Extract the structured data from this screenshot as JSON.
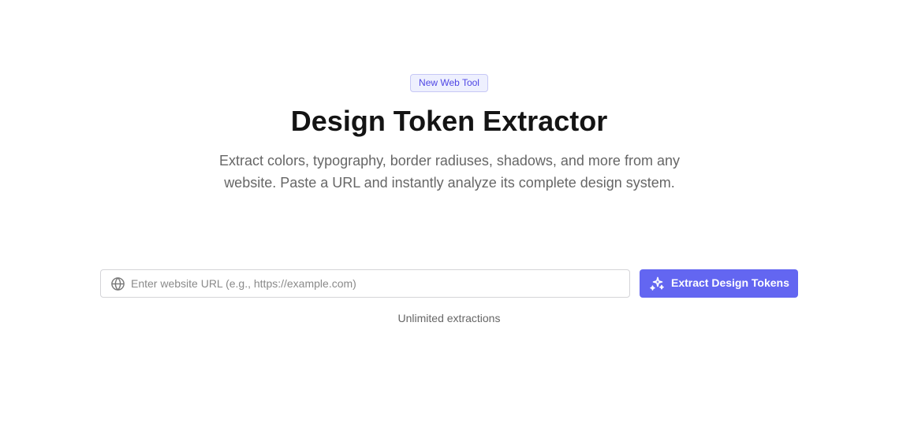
{
  "badge": {
    "label": "New Web Tool"
  },
  "hero": {
    "title": "Design Token Extractor",
    "subtitle": "Extract colors, typography, border radiuses, shadows, and more from any website. Paste a URL and instantly analyze its complete design system."
  },
  "search": {
    "placeholder": "Enter website URL (e.g., https://example.com)",
    "value": "",
    "icon": "globe-icon"
  },
  "action": {
    "label": "Extract Design Tokens",
    "icon": "sparkles-icon",
    "color": "#6366f1"
  },
  "footer": {
    "note": "Unlimited extractions"
  },
  "colors": {
    "accent": "#6366f1",
    "badge_background": "#eef0fe",
    "badge_border": "#c7c8f6",
    "heading": "#141414",
    "muted_text": "#666666"
  }
}
